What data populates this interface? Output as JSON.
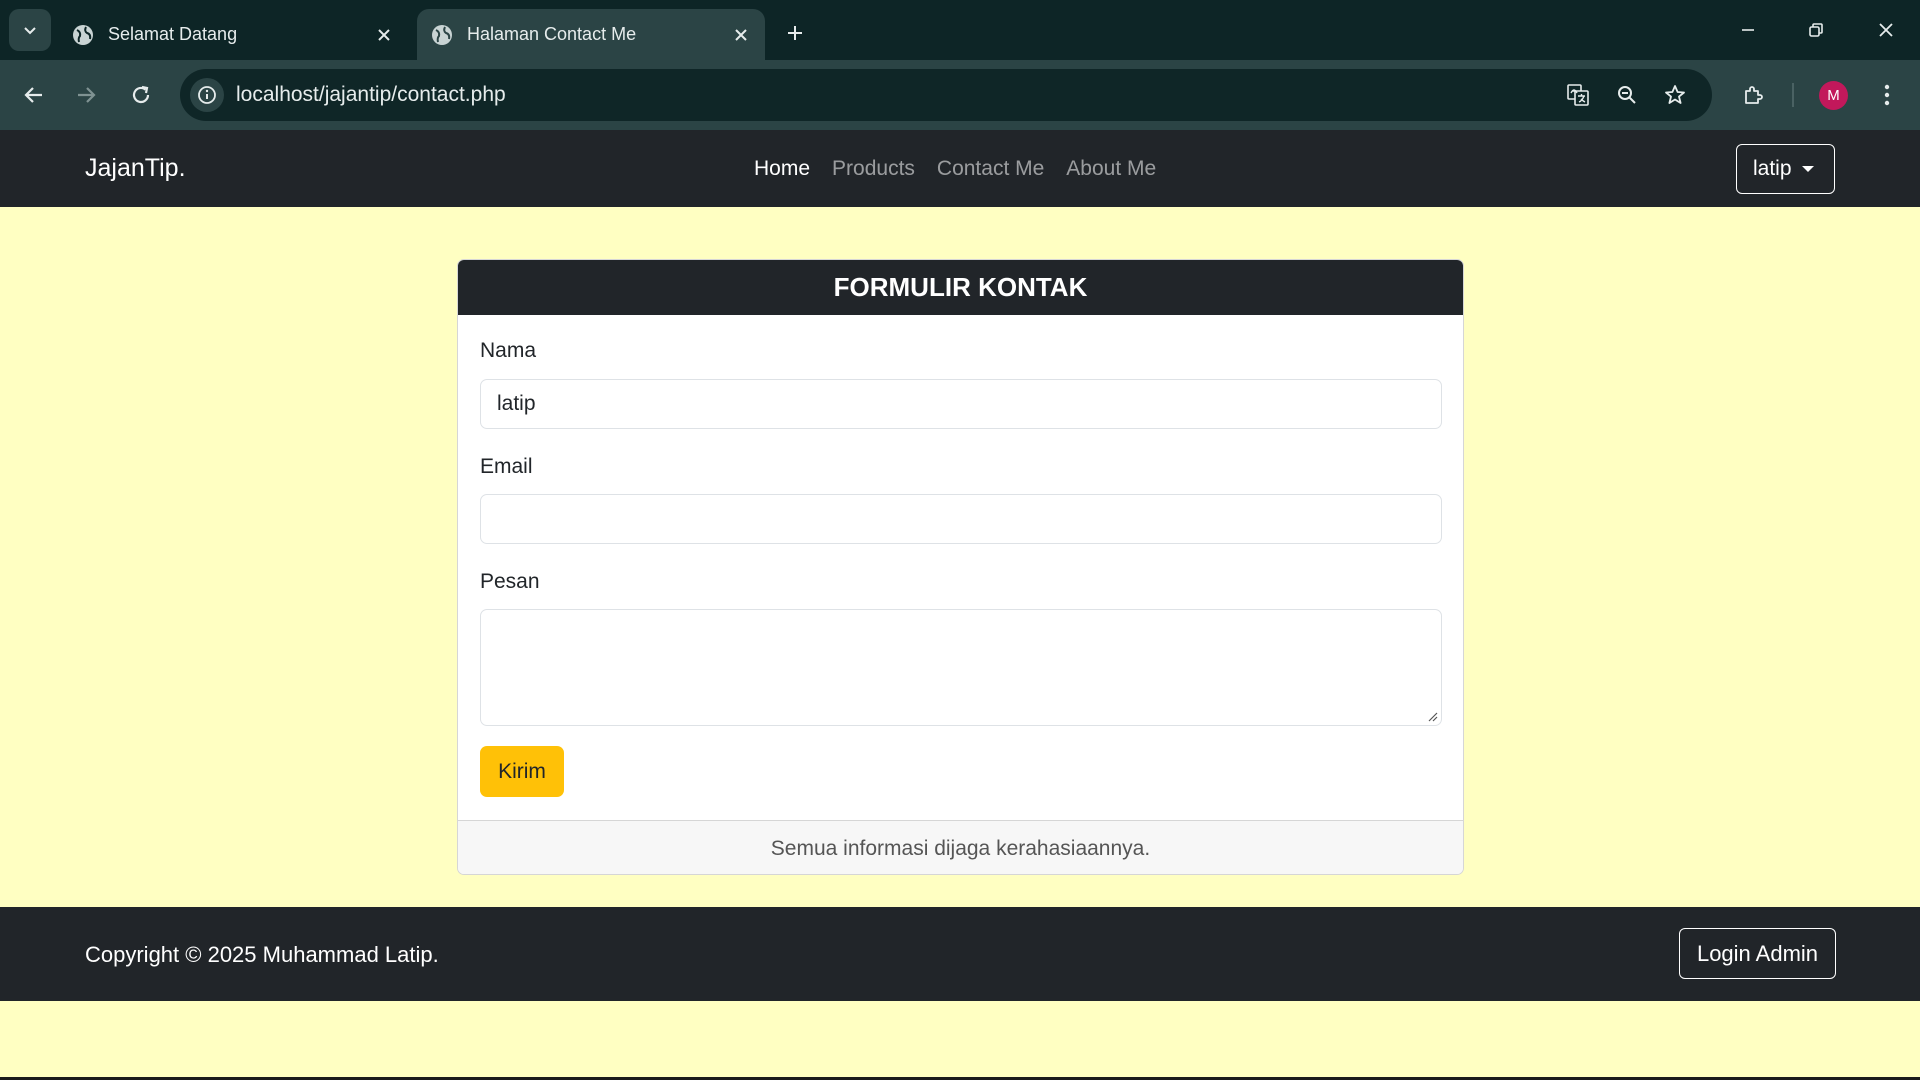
{
  "browser": {
    "tabs": [
      {
        "title": "Selamat Datang",
        "active": false
      },
      {
        "title": "Halaman Contact Me",
        "active": true
      }
    ],
    "url": "localhost/jajantip/contact.php",
    "profile_initial": "M",
    "colors": {
      "tabstrip": "#0d2526",
      "toolbar": "#2b4445",
      "profile": "#c2185b"
    }
  },
  "navbar": {
    "brand": "JajanTip.",
    "links": [
      {
        "label": "Home",
        "active": true
      },
      {
        "label": "Products",
        "active": false
      },
      {
        "label": "Contact Me",
        "active": false
      },
      {
        "label": "About Me",
        "active": false
      }
    ],
    "user_dropdown": "latip"
  },
  "contact_form": {
    "title": "FORMULIR KONTAK",
    "fields": {
      "name_label": "Nama",
      "name_value": "latip",
      "email_label": "Email",
      "email_value": "",
      "message_label": "Pesan",
      "message_value": ""
    },
    "submit_label": "Kirim",
    "footer_note": "Semua informasi dijaga kerahasiaannya."
  },
  "footer": {
    "copyright": "Copyright © 2025 Muhammad Latip.",
    "login_button": "Login Admin"
  },
  "theme": {
    "page_background": "#ffffc2",
    "dark": "#212529",
    "accent": "#ffc107"
  }
}
